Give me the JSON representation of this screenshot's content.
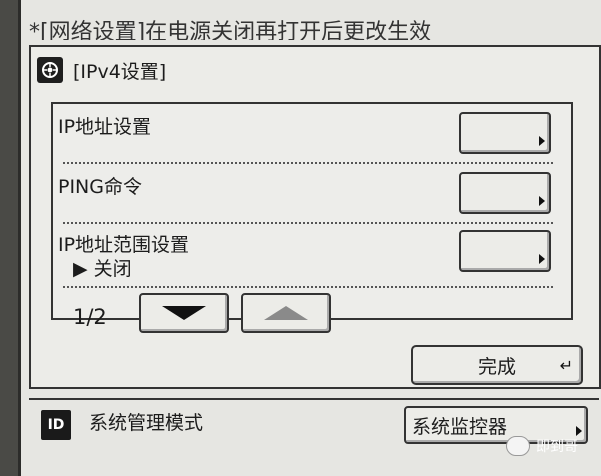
{
  "banner": {
    "text": "*[网络设置]在电源关闭再打开后更改生效"
  },
  "dialog": {
    "title": "[IPv4设置]"
  },
  "rows": [
    {
      "label": "IP地址设置",
      "sub": ""
    },
    {
      "label": "PING命令",
      "sub": ""
    },
    {
      "label": "IP地址范围设置",
      "sub": "▶ 关闭"
    }
  ],
  "pager": {
    "indicator": "1/2"
  },
  "done_label": "完成",
  "status": {
    "id_label": "ID",
    "mode": "系统管理模式",
    "monitor_label": "系统监控器"
  },
  "watermark": {
    "text": "即到哥"
  }
}
